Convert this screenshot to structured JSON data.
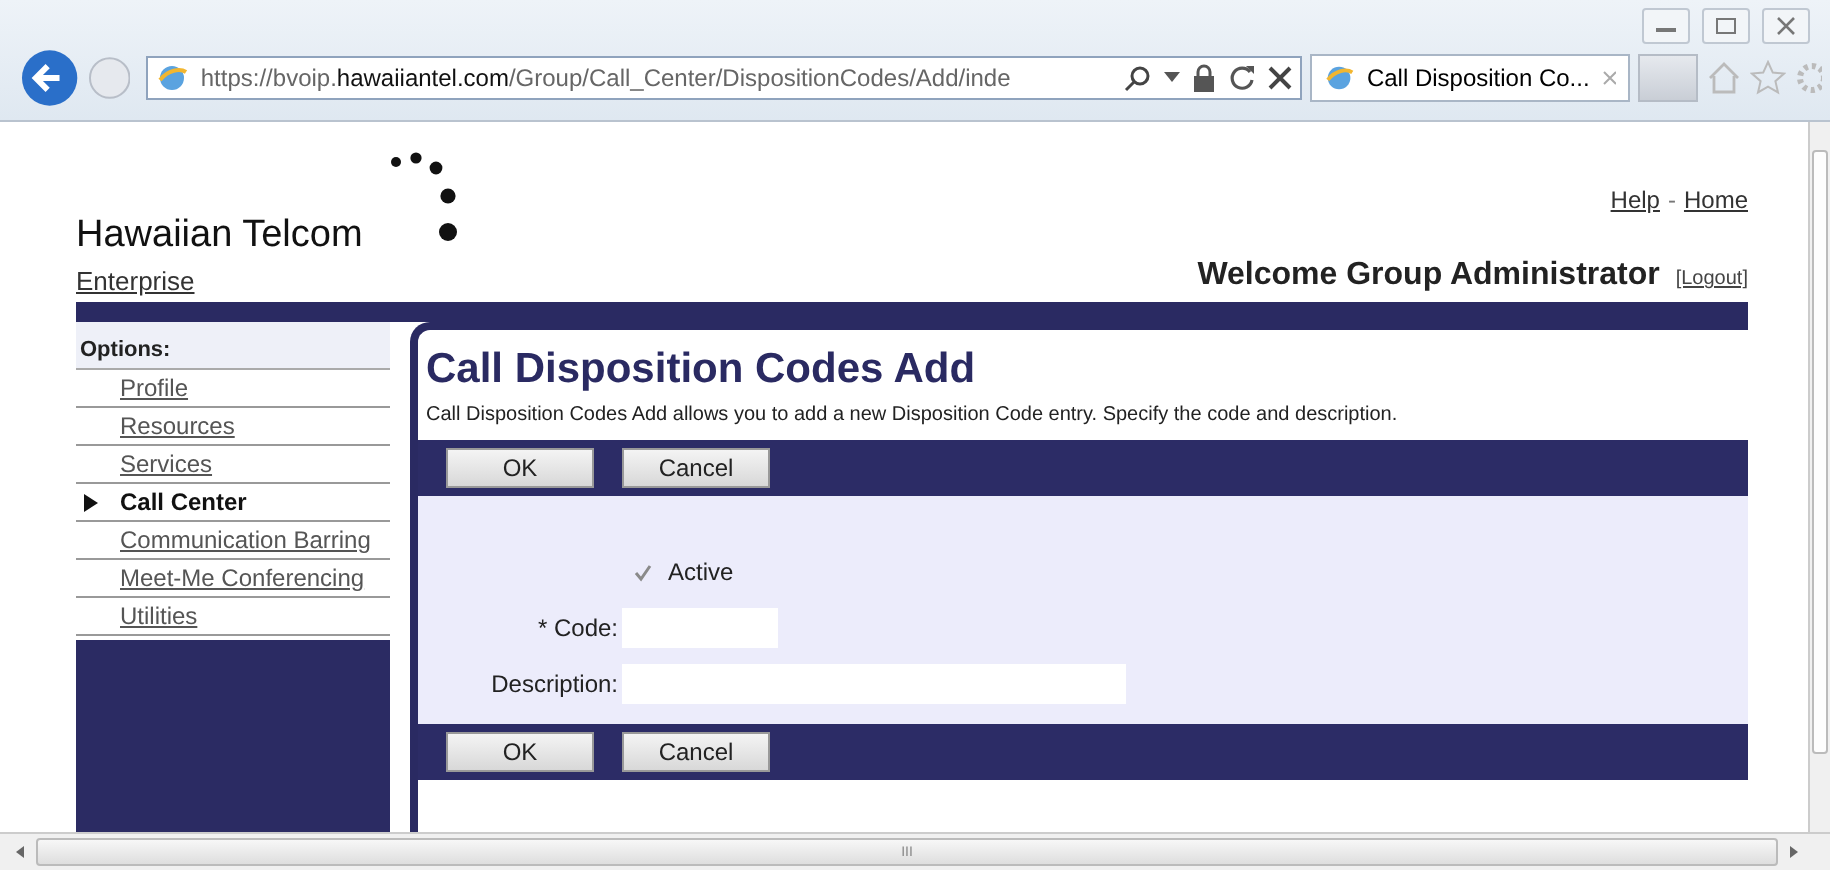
{
  "browser": {
    "url_prefix": "https://bvoip.",
    "url_domain": "hawaiiantel.com",
    "url_path": "/Group/Call_Center/DispositionCodes/Add/inde",
    "tab_title": "Call Disposition Co..."
  },
  "header": {
    "logo": "Hawaiian Telcom",
    "subtitle": "Enterprise",
    "links": [
      "Help",
      "Home"
    ],
    "separator": "-",
    "welcome": "Welcome Group Administrator",
    "logout": "[Logout]"
  },
  "sidebar": {
    "heading": "Options:",
    "items": [
      {
        "label": "Profile",
        "selected": false
      },
      {
        "label": "Resources",
        "selected": false
      },
      {
        "label": "Services",
        "selected": false
      },
      {
        "label": "Call Center",
        "selected": true
      },
      {
        "label": "Communication Barring",
        "selected": false
      },
      {
        "label": "Meet-Me Conferencing",
        "selected": false
      },
      {
        "label": "Utilities",
        "selected": false
      }
    ]
  },
  "main": {
    "title": "Call Disposition Codes Add",
    "description": "Call Disposition Codes Add allows you to add a new Disposition Code entry. Specify the code and description.",
    "top_buttons": [
      "OK",
      "Cancel"
    ],
    "active": {
      "label": "Active",
      "checked": true
    },
    "fields": [
      {
        "label": "* Code:",
        "kind": "short"
      },
      {
        "label": "Description:",
        "kind": "long"
      }
    ],
    "bottom_buttons": [
      "OK",
      "Cancel"
    ]
  },
  "status": {
    "scroll_mark": "III"
  }
}
